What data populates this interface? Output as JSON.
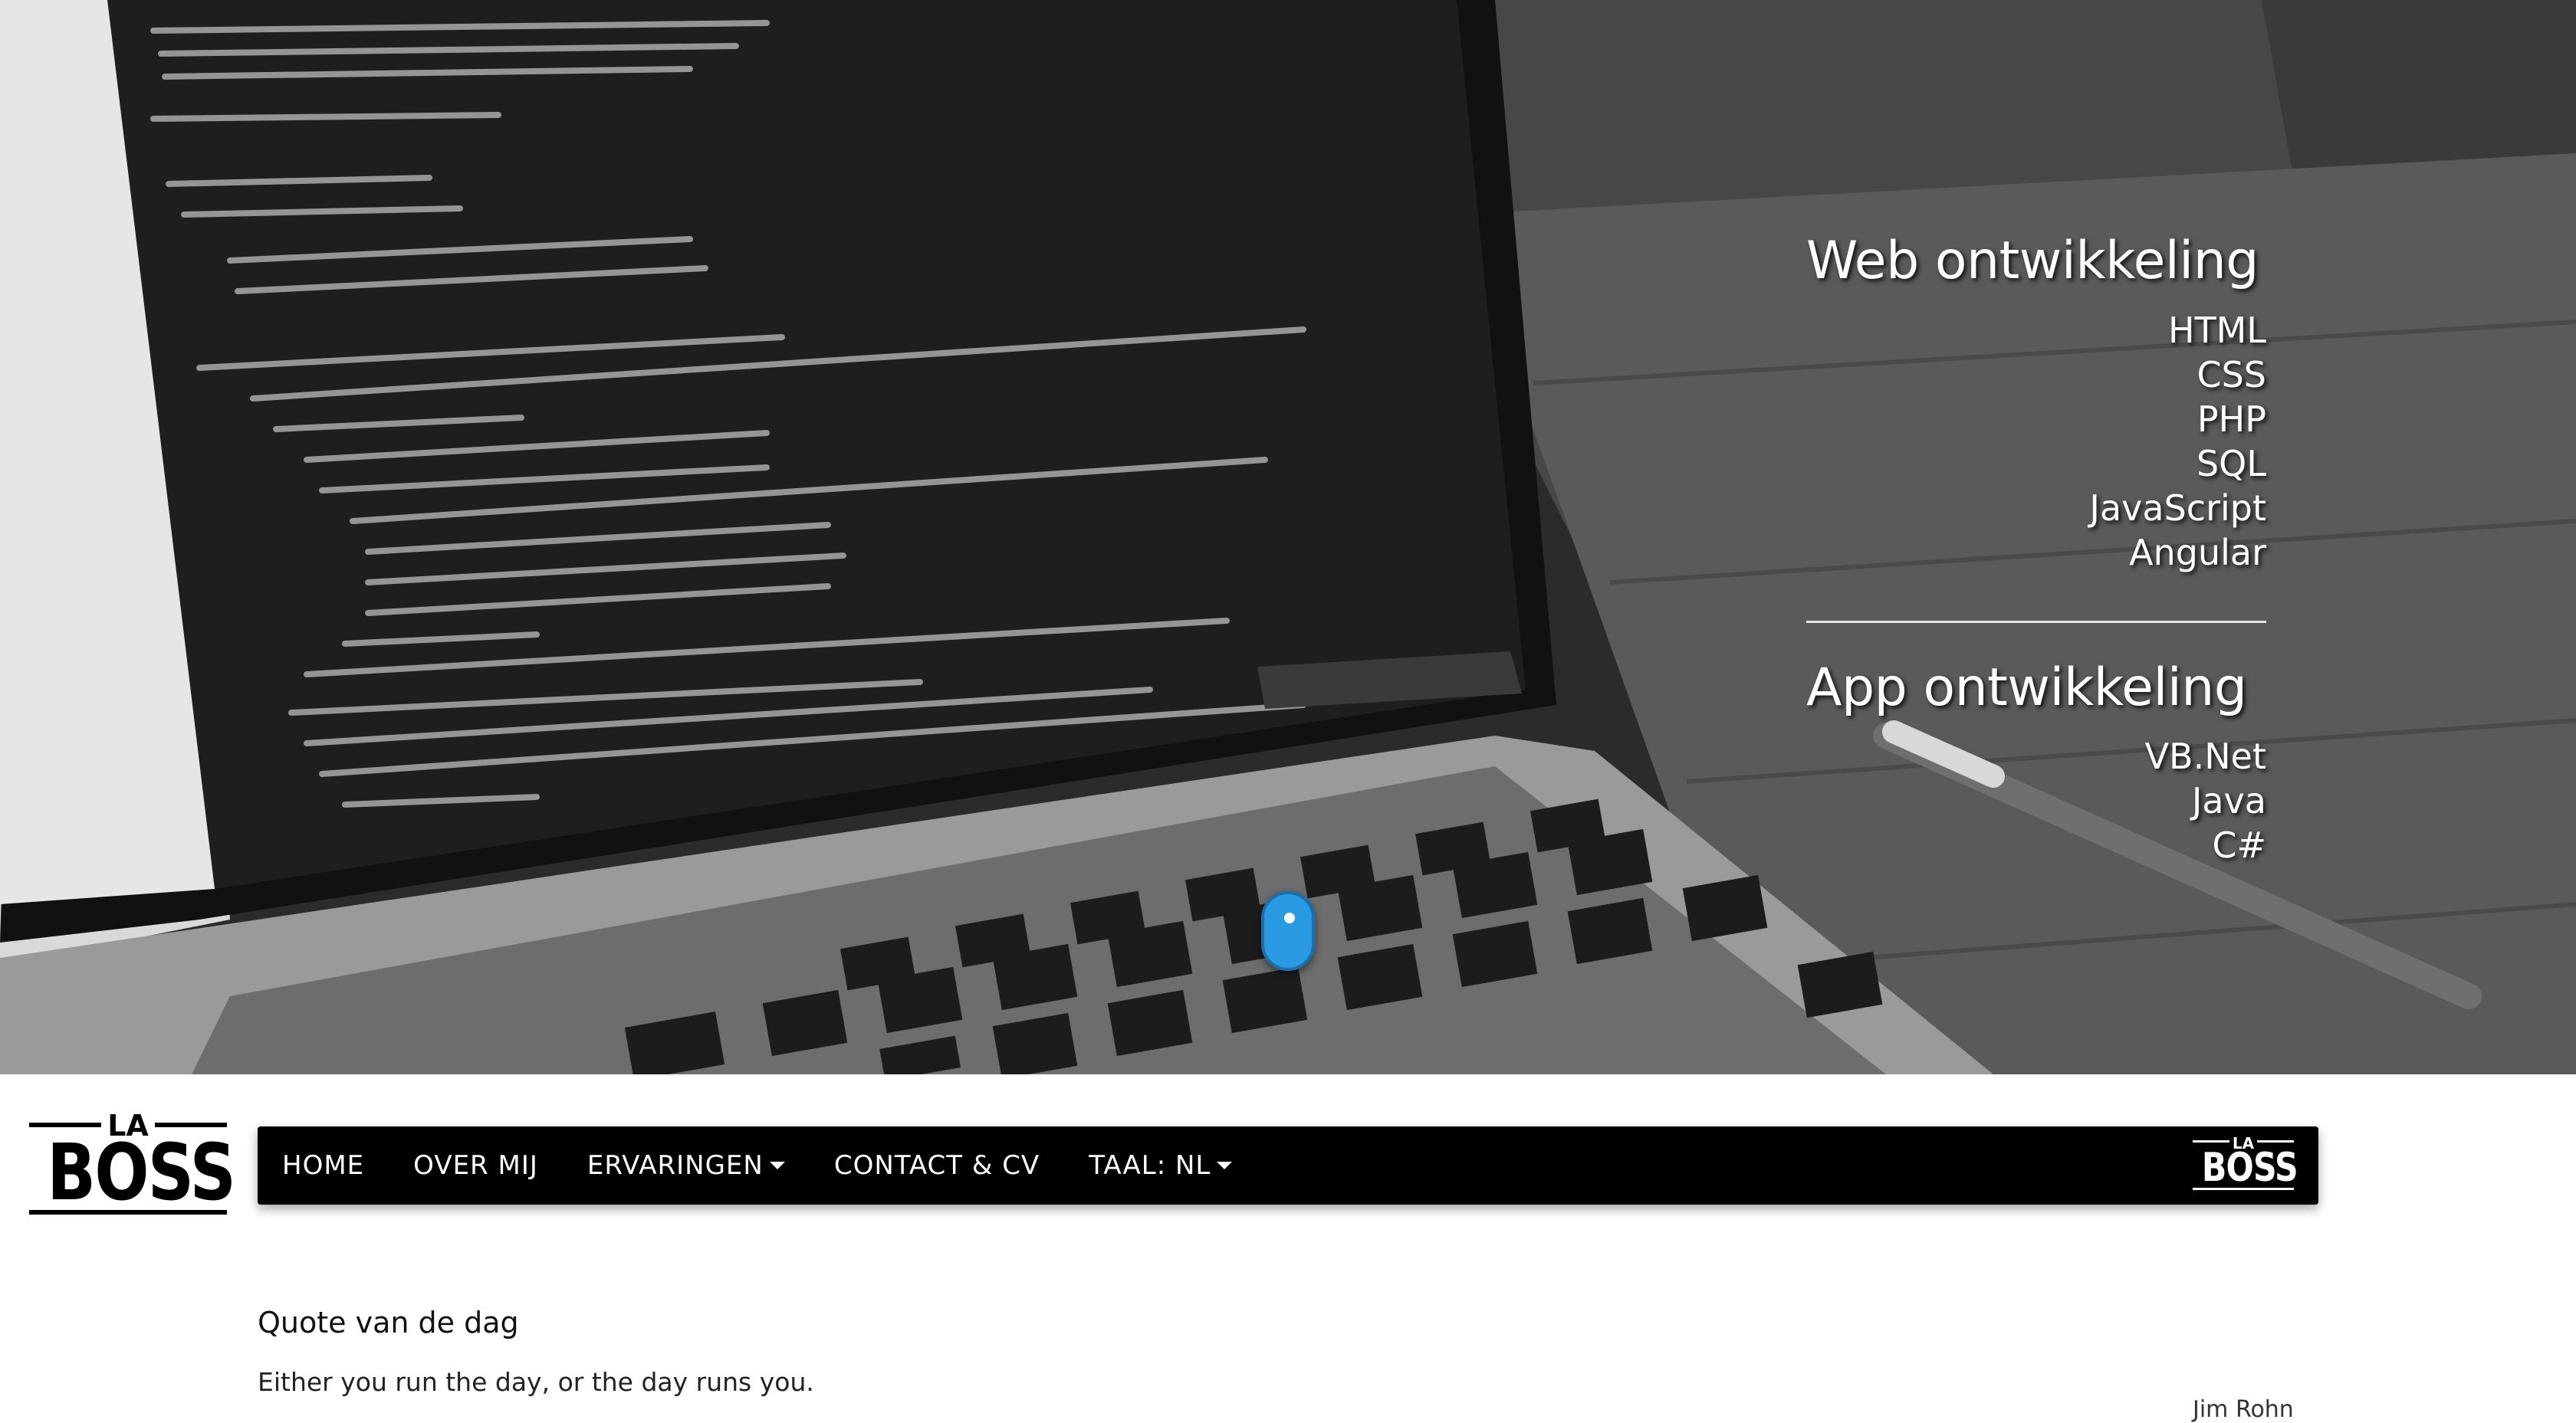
{
  "hero": {
    "web": {
      "heading": "Web ontwikkeling",
      "items": [
        "HTML",
        "CSS",
        "PHP",
        "SQL",
        "JavaScript",
        "Angular"
      ]
    },
    "app": {
      "heading": "App ontwikkeling",
      "items": [
        "VB.Net",
        "Java",
        "C#"
      ]
    }
  },
  "logo": {
    "top_text": "LA",
    "main_text": "BOSS"
  },
  "nav": {
    "items": [
      {
        "label": "HOME",
        "dropdown": false
      },
      {
        "label": "OVER MIJ",
        "dropdown": false
      },
      {
        "label": "ERVARINGEN",
        "dropdown": true
      },
      {
        "label": "CONTACT & CV",
        "dropdown": false
      },
      {
        "label": "TAAL: NL",
        "dropdown": true
      }
    ]
  },
  "quote": {
    "title": "Quote van de dag",
    "text": "Either you run the day, or the day runs you.",
    "author": "Jim Rohn"
  },
  "colors": {
    "nav_bg": "#000000",
    "scroll_indicator": "#2a9be3",
    "hero_text": "#ffffff"
  }
}
